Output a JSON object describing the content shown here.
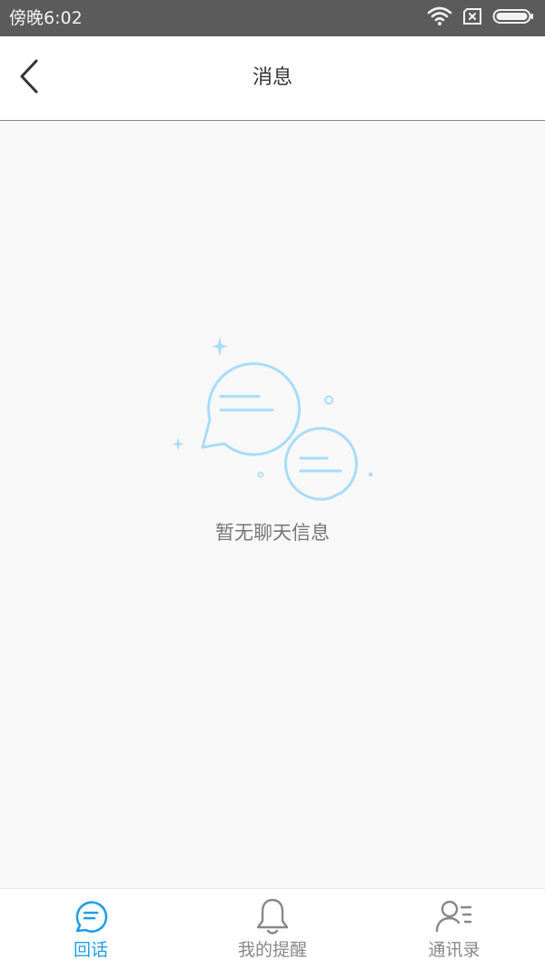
{
  "status_bar": {
    "time": "傍晚6:02",
    "icons": [
      "wifi-icon",
      "sim-card-icon",
      "battery-icon"
    ]
  },
  "header": {
    "back_icon": "chevron-left-icon",
    "title": "消息"
  },
  "empty_state": {
    "illustration": "chat-bubbles-icon",
    "message": "暂无聊天信息",
    "accent_color": "#a8dcf7"
  },
  "tab_bar": {
    "active_color": "#1e9ee6",
    "inactive_color": "#888888",
    "tabs": [
      {
        "label": "回话",
        "icon": "chat-bubble-icon",
        "active": true
      },
      {
        "label": "我的提醒",
        "icon": "bell-icon",
        "active": false
      },
      {
        "label": "通讯录",
        "icon": "contacts-icon",
        "active": false
      }
    ]
  }
}
